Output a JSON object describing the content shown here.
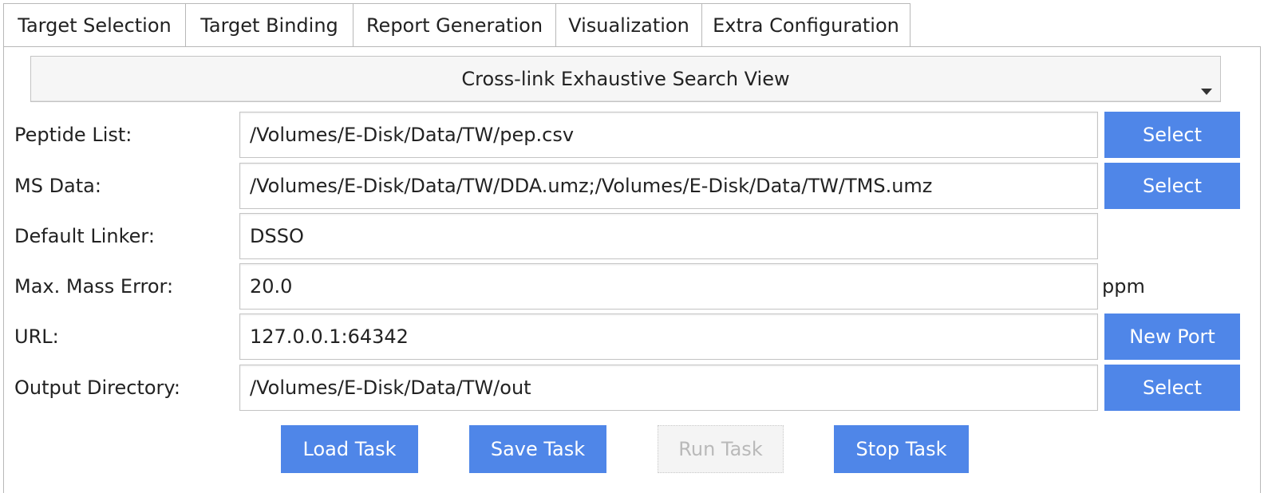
{
  "tabs": [
    {
      "label": "Target Selection"
    },
    {
      "label": "Target Binding"
    },
    {
      "label": "Report Generation"
    },
    {
      "label": "Visualization",
      "active": true
    },
    {
      "label": "Extra Configuration"
    }
  ],
  "view_selector": {
    "selected": "Cross-link Exhaustive Search View",
    "icon": "chevron-down-icon"
  },
  "form": {
    "peptide_list": {
      "label": "Peptide List:",
      "value": "/Volumes/E-Disk/Data/TW/pep.csv",
      "button": "Select"
    },
    "ms_data": {
      "label": "MS Data:",
      "value": "/Volumes/E-Disk/Data/TW/DDA.umz;/Volumes/E-Disk/Data/TW/TMS.umz",
      "button": "Select"
    },
    "default_linker": {
      "label": "Default Linker:",
      "value": "DSSO"
    },
    "max_mass_error": {
      "label": "Max. Mass Error:",
      "value": "20.0",
      "unit": "ppm"
    },
    "url": {
      "label": "URL:",
      "value": "127.0.0.1:64342",
      "button": "New Port"
    },
    "output_directory": {
      "label": "Output Directory:",
      "value": "/Volumes/E-Disk/Data/TW/out",
      "button": "Select"
    }
  },
  "actions": {
    "load": "Load Task",
    "save": "Save Task",
    "run": "Run Task",
    "stop": "Stop Task"
  },
  "colors": {
    "accent": "#4f86e8",
    "disabled_bg": "#f4f4f4",
    "disabled_text": "#b9b9b9"
  }
}
